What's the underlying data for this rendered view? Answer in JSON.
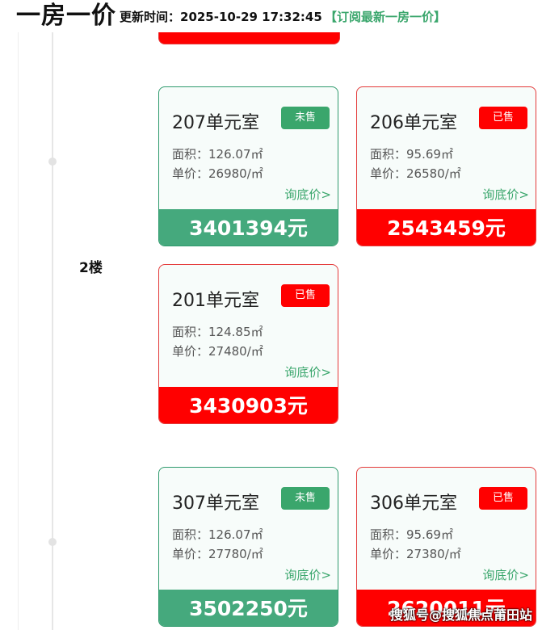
{
  "header": {
    "title": "一房一价",
    "update_label": "更新时间：2025-10-29 17:32:45",
    "subscribe_link": "【订阅最新一房一价】"
  },
  "floors": [
    {
      "label": "2楼"
    }
  ],
  "units": [
    {
      "title": "207单元室",
      "status": "未售",
      "area": "面积：126.07㎡",
      "unit_price": "单价：26980/㎡",
      "inquiry": "询底价>",
      "total": "3401394元"
    },
    {
      "title": "206单元室",
      "status": "已售",
      "area": "面积：95.69㎡",
      "unit_price": "单价：26580/㎡",
      "inquiry": "询底价>",
      "total": "2543459元"
    },
    {
      "title": "201单元室",
      "status": "已售",
      "area": "面积：124.85㎡",
      "unit_price": "单价：27480/㎡",
      "inquiry": "询底价>",
      "total": "3430903元"
    },
    {
      "title": "307单元室",
      "status": "未售",
      "area": "面积：126.07㎡",
      "unit_price": "单价：27780/㎡",
      "inquiry": "询底价>",
      "total": "3502250元"
    },
    {
      "title": "306单元室",
      "status": "已售",
      "area": "面积：95.69㎡",
      "unit_price": "单价：27380/㎡",
      "inquiry": "询底价>",
      "total": "2620011元"
    }
  ],
  "watermark": "搜狐号@搜狐焦点莆田站",
  "colors": {
    "unsold": "#3aa66c",
    "sold": "#ff0000",
    "unsold_total_bar": "#45a97d"
  }
}
